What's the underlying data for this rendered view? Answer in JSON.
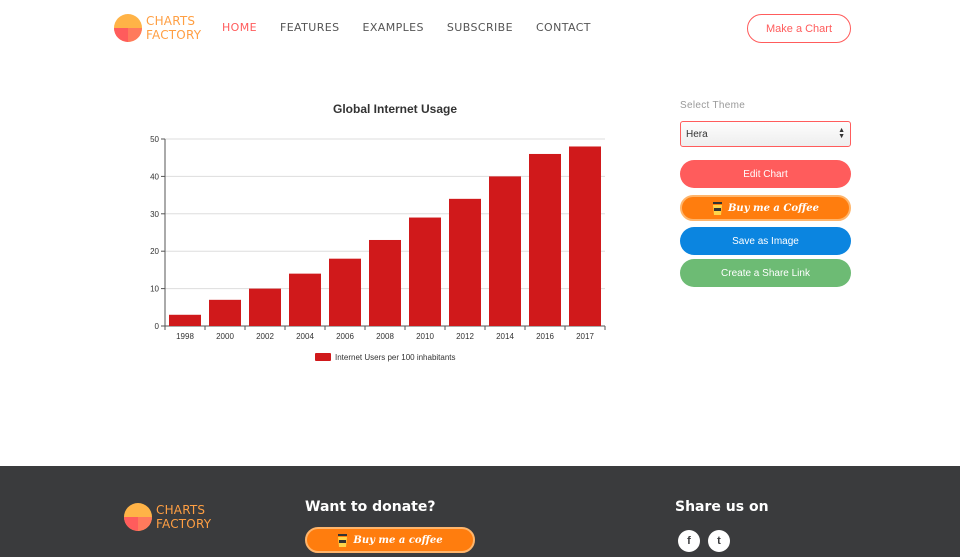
{
  "header": {
    "logo": {
      "line1": "CHARTS",
      "line2": "FACTORY"
    },
    "nav": [
      {
        "label": "HOME",
        "active": true
      },
      {
        "label": "FEATURES",
        "active": false
      },
      {
        "label": "EXAMPLES",
        "active": false
      },
      {
        "label": "SUBSCRIBE",
        "active": false
      },
      {
        "label": "CONTACT",
        "active": false
      }
    ],
    "make_chart_label": "Make a Chart"
  },
  "panel": {
    "theme_label": "Select Theme",
    "theme_value": "Hera",
    "edit_label": "Edit Chart",
    "coffee_label": "Buy me a Coffee",
    "save_label": "Save as Image",
    "share_label": "Create a Share Link"
  },
  "footer": {
    "logo": {
      "line1": "CHARTS",
      "line2": "FACTORY"
    },
    "donate_title": "Want to donate?",
    "coffee_label": "Buy me a coffee",
    "share_title": "Share us on",
    "social": [
      {
        "icon": "facebook-icon",
        "glyph": "f"
      },
      {
        "icon": "twitter-icon",
        "glyph": "t"
      }
    ]
  },
  "colors": {
    "accent": "#ff5c5c",
    "bar": "#d0191b",
    "coffee": "#ff7d0e",
    "save": "#0b85e0",
    "share": "#6dbb74",
    "footer_bg": "#3a3b3d"
  },
  "chart_data": {
    "type": "bar",
    "title": "Global Internet Usage",
    "categories": [
      "1998",
      "2000",
      "2002",
      "2004",
      "2006",
      "2008",
      "2010",
      "2012",
      "2014",
      "2016",
      "2017"
    ],
    "series": [
      {
        "name": "Internet Users per 100 inhabitants",
        "values": [
          3,
          7,
          10,
          14,
          18,
          23,
          29,
          34,
          40,
          46,
          48
        ]
      }
    ],
    "ylim": [
      0,
      50
    ],
    "yticks": [
      0,
      10,
      20,
      30,
      40,
      50
    ],
    "grid": true,
    "legend": "bottom"
  }
}
